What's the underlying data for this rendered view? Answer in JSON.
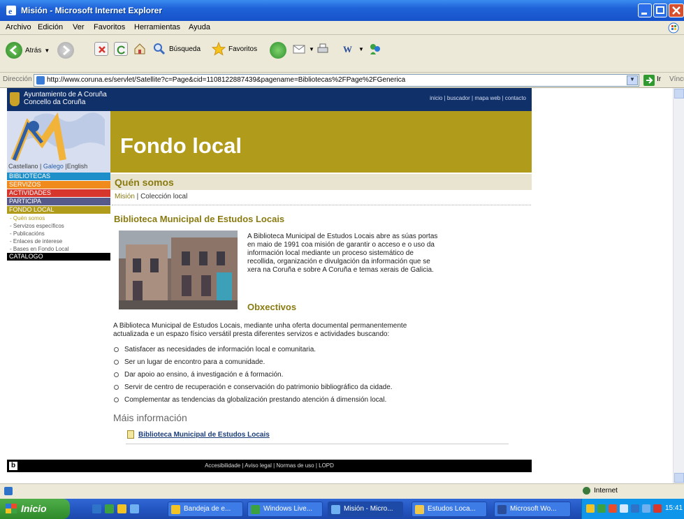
{
  "window": {
    "title": "Misión - Microsoft Internet Explorer"
  },
  "menubar": {
    "items": [
      "Archivo",
      "Edición",
      "Ver",
      "Favoritos",
      "Herramientas",
      "Ayuda"
    ]
  },
  "toolbar": {
    "back": "Atrás",
    "search": "Búsqueda",
    "favorites": "Favoritos"
  },
  "address": {
    "label": "Dirección",
    "url": "http://www.coruna.es/servlet/Satellite?c=Page&cid=1108122887439&pagename=Bibliotecas%2FPage%2FGenerica",
    "go": "Ir",
    "links": "Vínculos"
  },
  "site": {
    "org_line1": "Ayuntamiento de A Coruña",
    "org_line2": "Concello da Coruña",
    "toplinks": "inicio | buscador | mapa web | contacto",
    "banner_title": "Fondo local",
    "languages": {
      "castellano": "Castellano",
      "sep1": " | ",
      "galego": "Galego",
      "sep2": " |",
      "english": "English"
    },
    "menu": [
      {
        "label": "BIBLIOTECAS",
        "color": "#1e8fc8"
      },
      {
        "label": "SERVIZOS",
        "color": "#f08a1c"
      },
      {
        "label": "ACTIVIDADES",
        "color": "#d6362c"
      },
      {
        "label": "PARTICIPA",
        "color": "#555a8a"
      },
      {
        "label": "FONDO LOCAL",
        "color": "#b09b1a"
      }
    ],
    "submenu": [
      "- Quén somos",
      "- Servizos específicos",
      "- Publicacións",
      "- Enlaces de interese",
      "- Bases en Fondo Local"
    ],
    "catalog": {
      "label": "CATALOGO",
      "color": "#000000"
    },
    "section_title": "Quén somos",
    "subnav_active": "Misión",
    "subnav_sep": " | ",
    "subnav_other": "Colección local",
    "heading": "Biblioteca Municipal de Estudos Locais",
    "intro_1": "A Biblioteca Municipal de Estudos Locais abre as súas portas",
    "intro_2": "en maio de 1991 coa misión de garantir o acceso e o uso da",
    "intro_3": "información local mediante un proceso sistemático de",
    "intro_4": "recollida, organización e divulgación da información que se",
    "intro_5": "xera na Coruña e sobre A Coruña e temas xerais de Galicia.",
    "objectives_heading": "Obxectivos",
    "objectives_intro_1": "A Biblioteca Municipal de Estudos Locais, mediante unha oferta documental permanentemente",
    "objectives_intro_2": "actualizada e un espazo físico versátil presta diferentes servizos e actividades buscando:",
    "objectives": [
      "Satisfacer as necesidades de información local e comunitaria.",
      "Ser un lugar de encontro para a comunidade.",
      "Dar apoio ao ensino, á investigación e á formación.",
      "Servir de centro de recuperación e conservación do patrimonio bibliográfico da cidade.",
      "Complementar as tendencias da globalización prestando atención á dimensión local."
    ],
    "more_info": "Máis información",
    "more_link": "Biblioteca Municipal de Estudos Locais",
    "footer_links": "Accesibilidade | Aviso legal | Normas de uso | LOPD"
  },
  "status": {
    "zone": "Internet"
  },
  "taskbar": {
    "start": "Inicio",
    "tasks": [
      "Bandeja de e...",
      "Windows Live...",
      "Misión - Micro...",
      "Estudos Loca...",
      "Microsoft Wo..."
    ],
    "clock": "15:41"
  }
}
